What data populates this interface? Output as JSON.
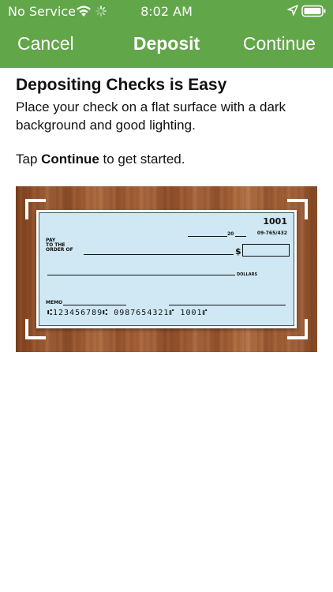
{
  "status_bar": {
    "carrier": "No Service",
    "time": "8:02 AM",
    "icons": [
      "wifi-icon",
      "activity-spinner-icon",
      "location-arrow-icon",
      "battery-icon"
    ]
  },
  "nav": {
    "cancel_label": "Cancel",
    "title": "Deposit",
    "continue_label": "Continue"
  },
  "content": {
    "heading": "Depositing Checks is Easy",
    "description": "Place your check on a flat surface with a dark background and good lighting.",
    "tap_prefix": "Tap ",
    "tap_bold": "Continue",
    "tap_suffix": " to get started."
  },
  "check": {
    "number": "1001",
    "routing_fraction": "09-765/432",
    "date_year_prefix": "20",
    "pay_to_line1": "PAY",
    "pay_to_line2": "TO THE",
    "pay_to_line3": "ORDER OF",
    "dollar_sign": "$",
    "dollars_label": "DOLLARS",
    "memo_label": "MEMO",
    "micr_line": "⑆123456789⑆  0987654321⑈  1001⑈"
  },
  "colors": {
    "header_green": "#62a64a",
    "check_blue": "#cfe8f4",
    "wood_brown": "#a9643a"
  }
}
